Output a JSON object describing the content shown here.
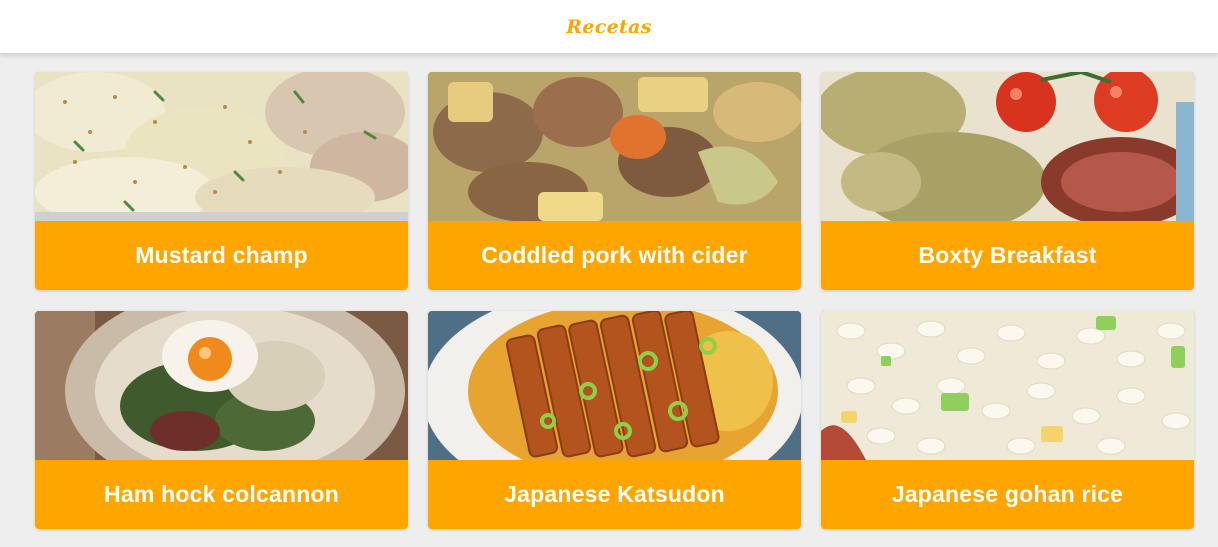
{
  "header": {
    "title": "Recetas"
  },
  "recipes": [
    {
      "name": "Mustard champ",
      "image": "mashed-potatoes-with-mustard"
    },
    {
      "name": "Coddled pork with cider",
      "image": "pork-stew-with-carrots-and-cabbage"
    },
    {
      "name": "Boxty Breakfast",
      "image": "potato-pancakes-tomatoes-bacon"
    },
    {
      "name": "Ham hock colcannon",
      "image": "colcannon-with-fried-egg"
    },
    {
      "name": "Japanese Katsudon",
      "image": "sliced-pork-cutlet-on-rice"
    },
    {
      "name": "Japanese gohan rice",
      "image": "fried-rice-close-up"
    }
  ],
  "colors": {
    "accent": "#ffa500",
    "background": "#eeeeee",
    "header_bg": "#ffffff",
    "caption_text": "#ffffff"
  }
}
